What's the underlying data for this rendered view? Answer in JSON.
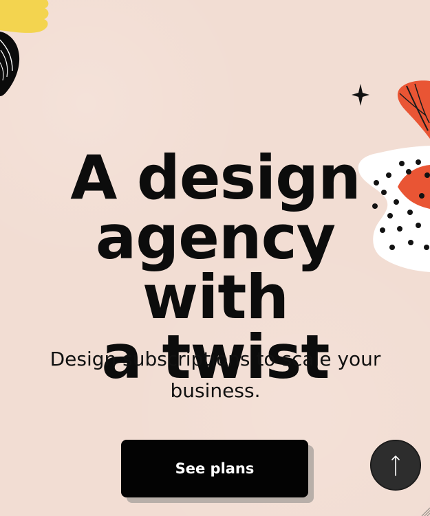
{
  "hero": {
    "title": "A design\nagency with\na twist",
    "subtitle": "Design subscriptions to scale your business."
  },
  "cta": {
    "label": "See plans"
  },
  "icons": {
    "scroll_top": "arrow-up-icon",
    "decorations": [
      "yellow-blob-icon",
      "black-leaf-icon",
      "sparkle-icon",
      "orange-leaf-icon",
      "white-blob-dots-icon",
      "resize-grip-icon"
    ]
  },
  "colors": {
    "background": "#f2ddd3",
    "text": "#0c0c0c",
    "button": "#030303",
    "button_text": "#ffffff",
    "button_shadow": "#b8afa9",
    "accent_orange": "#e95534",
    "accent_yellow": "#f3d44f",
    "scroll_button": "#2d2d2d"
  }
}
